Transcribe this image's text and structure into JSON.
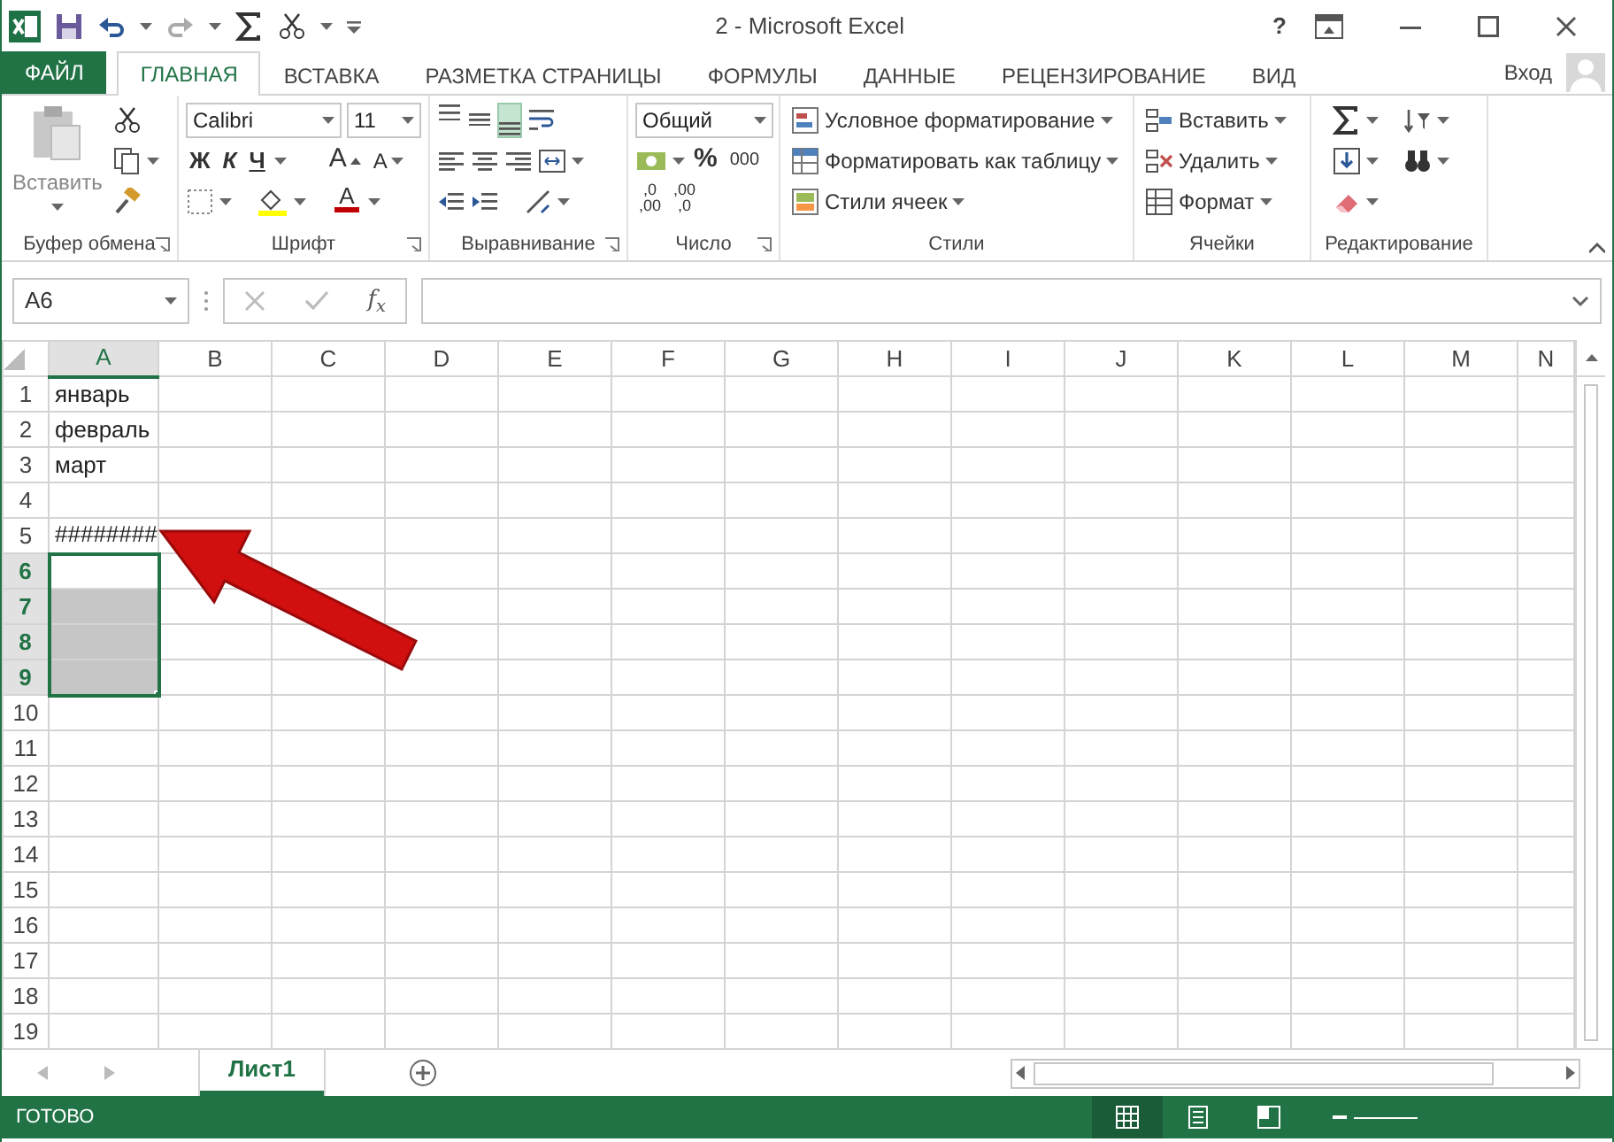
{
  "window": {
    "title": "2 - Microsoft Excel",
    "help": "?"
  },
  "tabs": [
    {
      "label": "ФАЙЛ",
      "kind": "file",
      "selected": false
    },
    {
      "label": "ГЛАВНАЯ",
      "kind": "tab",
      "selected": true
    },
    {
      "label": "ВСТАВКА",
      "kind": "tab",
      "selected": false
    },
    {
      "label": "РАЗМЕТКА СТРАНИЦЫ",
      "kind": "tab",
      "selected": false
    },
    {
      "label": "ФОРМУЛЫ",
      "kind": "tab",
      "selected": false
    },
    {
      "label": "ДАННЫЕ",
      "kind": "tab",
      "selected": false
    },
    {
      "label": "РЕЦЕНЗИРОВАНИЕ",
      "kind": "tab",
      "selected": false
    },
    {
      "label": "ВИД",
      "kind": "tab",
      "selected": false
    }
  ],
  "account": {
    "label": "Вход"
  },
  "ribbon": {
    "clipboard": {
      "title": "Буфер обмена",
      "paste": "Вставить"
    },
    "font": {
      "title": "Шрифт",
      "family": "Calibri",
      "size": "11",
      "bold": "Ж",
      "italic": "К",
      "underline": "Ч",
      "grow": "A",
      "shrink": "A",
      "font_color_label": "A"
    },
    "alignment": {
      "title": "Выравнивание",
      "vertical": [
        {
          "selected": false
        },
        {
          "selected": false
        },
        {
          "selected": true
        }
      ]
    },
    "number": {
      "title": "Число",
      "format": "Общий",
      "percent": "%",
      "thousands": "000",
      "decimals": [
        {
          "top": ",0",
          "bottom": ",00"
        },
        {
          "top": ",00",
          "bottom": ",0"
        }
      ]
    },
    "styles": {
      "title": "Стили",
      "items": [
        "Условное форматирование",
        "Форматировать как таблицу",
        "Стили ячеек"
      ]
    },
    "cells": {
      "title": "Ячейки",
      "items": [
        "Вставить",
        "Удалить",
        "Формат"
      ]
    },
    "editing": {
      "title": "Редактирование"
    }
  },
  "formula_bar": {
    "name_box": "A6",
    "fx": "f$_{x}$"
  },
  "sheet": {
    "columns": [
      {
        "label": "A",
        "selected": true
      },
      {
        "label": "B",
        "selected": false
      },
      {
        "label": "C",
        "selected": false
      },
      {
        "label": "D",
        "selected": false
      },
      {
        "label": "E",
        "selected": false
      },
      {
        "label": "F",
        "selected": false
      },
      {
        "label": "G",
        "selected": false
      },
      {
        "label": "H",
        "selected": false
      },
      {
        "label": "I",
        "selected": false
      },
      {
        "label": "J",
        "selected": false
      },
      {
        "label": "K",
        "selected": false
      },
      {
        "label": "L",
        "selected": false
      },
      {
        "label": "M",
        "selected": false
      },
      {
        "label": "N",
        "selected": false
      }
    ],
    "rows": [
      {
        "label": "1",
        "selected": false,
        "cells": [
          "январь"
        ]
      },
      {
        "label": "2",
        "selected": false,
        "cells": [
          "февраль"
        ]
      },
      {
        "label": "3",
        "selected": false,
        "cells": [
          "март"
        ]
      },
      {
        "label": "4",
        "selected": false
      },
      {
        "label": "5",
        "selected": false,
        "cells": [
          "########"
        ]
      },
      {
        "label": "6",
        "selected": true,
        "active": true
      },
      {
        "label": "7",
        "selected": true,
        "active": false
      },
      {
        "label": "8",
        "selected": true,
        "active": false
      },
      {
        "label": "9",
        "selected": true,
        "active": false
      },
      {
        "label": "10",
        "selected": false
      },
      {
        "label": "11",
        "selected": false
      },
      {
        "label": "12",
        "selected": false
      },
      {
        "label": "13",
        "selected": false
      },
      {
        "label": "14",
        "selected": false
      },
      {
        "label": "15",
        "selected": false
      },
      {
        "label": "16",
        "selected": false
      },
      {
        "label": "17",
        "selected": false
      },
      {
        "label": "18",
        "selected": false
      },
      {
        "label": "19",
        "selected": false
      }
    ]
  },
  "sheet_tabs": [
    {
      "label": "Лист1",
      "selected": true
    }
  ],
  "status_bar": {
    "text": "ГОТОВО",
    "views": [
      {
        "selected": true
      },
      {
        "selected": false
      },
      {
        "selected": false
      }
    ]
  }
}
